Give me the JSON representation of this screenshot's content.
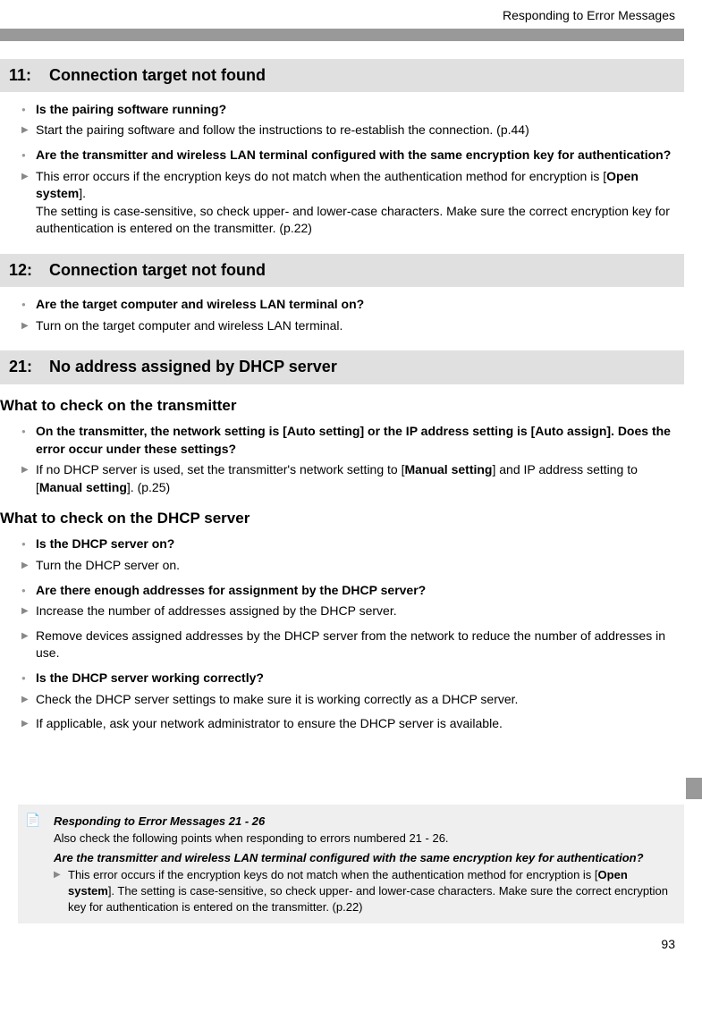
{
  "running_head": "Responding to Error Messages",
  "sections": [
    {
      "code": "11:",
      "title": "Connection target not found",
      "subhead_before": "",
      "items": [
        {
          "q": "Is the pairing software running?",
          "a": [
            "Start the pairing software and follow the instructions to re-establish the connection. (p.44)"
          ]
        },
        {
          "q": "Are the transmitter and wireless LAN terminal configured with the same encryption key for authentication?",
          "a": [
            "This error occurs if the encryption keys do not match when the authentication method for encryption is [<strong>Open system</strong>].<br>The setting is case-sensitive, so check upper- and lower-case characters. Make sure the correct encryption key for authentication is entered on the transmitter. (p.22)"
          ]
        }
      ]
    },
    {
      "code": "12:",
      "title": "Connection target not found",
      "items": [
        {
          "q": "Are the target computer and wireless LAN terminal on?",
          "a": [
            "Turn on the target computer and wireless LAN terminal."
          ]
        }
      ]
    },
    {
      "code": "21:",
      "title": "No address assigned by DHCP server",
      "groups": [
        {
          "subhead": "What to check on the transmitter",
          "items": [
            {
              "q": "On the transmitter, the network setting is [Auto setting] or the IP address setting is [Auto assign]. Does the error occur under these settings?",
              "a": [
                "If no DHCP server is used, set the transmitter's network setting to [<strong>Manual setting</strong>] and IP address setting to [<strong>Manual setting</strong>]. (p.25)"
              ]
            }
          ]
        },
        {
          "subhead": "What to check on the DHCP server",
          "items": [
            {
              "q": "Is the DHCP server on?",
              "a": [
                "Turn the DHCP server on."
              ]
            },
            {
              "q": "Are there enough addresses for assignment by the DHCP server?",
              "a": [
                "Increase the number of addresses assigned by the DHCP server.",
                "Remove devices assigned addresses by the DHCP server from the network to reduce the number of addresses in use."
              ]
            },
            {
              "q": "Is the DHCP server working correctly?",
              "a": [
                "Check the DHCP server settings to make sure it is working correctly as a DHCP server.",
                "If applicable, ask your network administrator to ensure the DHCP server is available."
              ]
            }
          ]
        }
      ]
    }
  ],
  "note": {
    "title": "Responding to Error Messages 21 - 26",
    "intro": "Also check the following points when responding to errors numbered 21 - 26.",
    "q": "Are the transmitter and wireless LAN terminal configured with the same encryption key for authentication?",
    "a": "This error occurs if the encryption keys do not match when the authentication method for encryption is [<strong>Open system</strong>]. The setting is case-sensitive, so check upper- and lower-case characters. Make sure the correct encryption key for authentication is entered on the transmitter. (p.22)"
  },
  "page_number": "93"
}
